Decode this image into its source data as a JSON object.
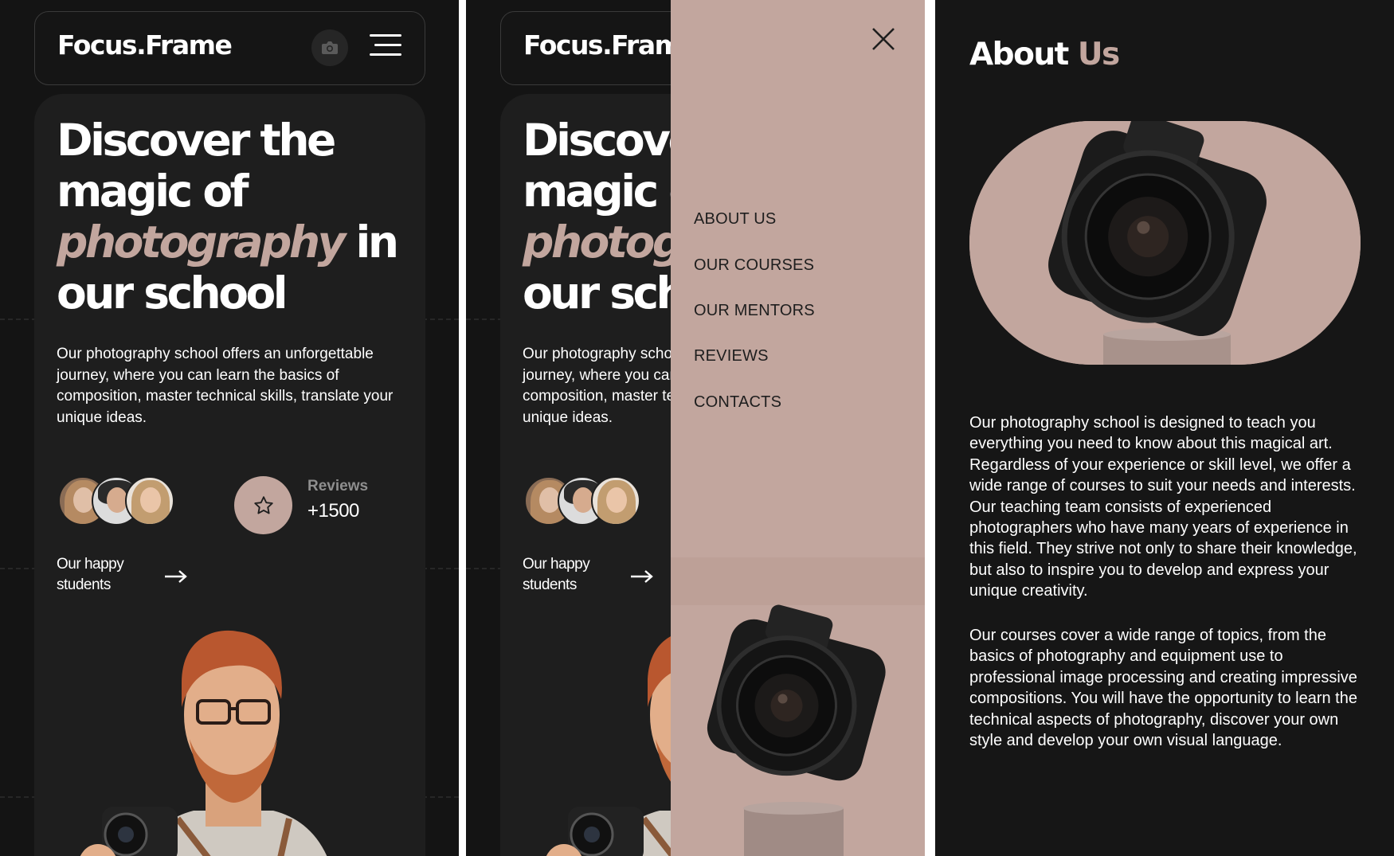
{
  "brand": {
    "logo": "Focus.Frame"
  },
  "hero": {
    "headline": {
      "line1": "Discover the",
      "line2": "magic of",
      "highlight": "photography",
      "after_highlight": " in",
      "line4": "our school"
    },
    "lead": "Our photography school offers an unforgettable journey, where you can learn the basics of composition, master technical skills, translate your unique ideas.",
    "reviews_label": "Reviews",
    "reviews_count": "+1500",
    "students_label": "Our happy students"
  },
  "menu": {
    "items": [
      "ABOUT US",
      "OUR COURSES",
      "OUR MENTORS",
      "REVIEWS",
      "CONTACTS"
    ]
  },
  "about": {
    "title_main": "About",
    "title_accent": "Us",
    "paragraph1": "Our photography school is designed to teach you everything you need to know about this magical art. Regardless of your experience or skill level, we offer a wide range of courses to suit your needs and interests. Our teaching team consists of experienced photographers who have many years of experience in this field. They strive not only to share their knowledge, but also to inspire you to develop and express your unique creativity.",
    "paragraph2": "Our courses cover a wide range of topics, from the basics of photography and equipment use to professional image processing and creating impressive compositions. You will have the opportunity to learn the technical aspects of photography, discover your own style and develop your own visual language."
  },
  "icons": [
    "camera-icon",
    "hamburger-menu-icon",
    "star-icon",
    "arrow-right-icon",
    "close-icon"
  ],
  "colors": {
    "background": "#141414",
    "card": "#1e1e1e",
    "accent": "#c2a69e",
    "text": "#ffffff",
    "muted": "#8e8e8e"
  }
}
